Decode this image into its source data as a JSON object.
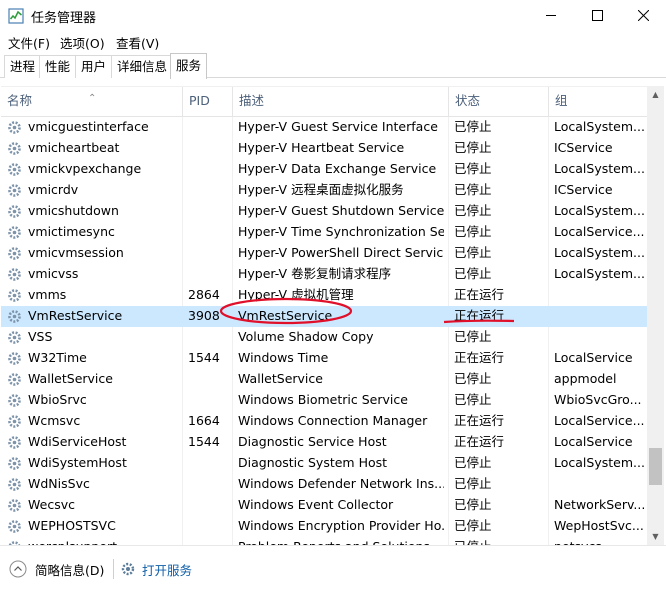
{
  "window": {
    "title": "任务管理器",
    "minimize": "—",
    "maximize": "☐",
    "close": "✕"
  },
  "menu": [
    "文件(F)",
    "选项(O)",
    "查看(V)"
  ],
  "tabs": [
    "进程",
    "性能",
    "用户",
    "详细信息",
    "服务"
  ],
  "active_tab": "服务",
  "columns": [
    "名称",
    "PID",
    "描述",
    "状态",
    "组"
  ],
  "rows": [
    {
      "name": "vmicguestinterface",
      "pid": "",
      "desc": "Hyper-V Guest Service Interface",
      "status": "已停止",
      "group": "LocalSystem..."
    },
    {
      "name": "vmicheartbeat",
      "pid": "",
      "desc": "Hyper-V Heartbeat Service",
      "status": "已停止",
      "group": "ICService"
    },
    {
      "name": "vmickvpexchange",
      "pid": "",
      "desc": "Hyper-V Data Exchange Service",
      "status": "已停止",
      "group": "LocalSystem..."
    },
    {
      "name": "vmicrdv",
      "pid": "",
      "desc": "Hyper-V 远程桌面虚拟化服务",
      "status": "已停止",
      "group": "ICService"
    },
    {
      "name": "vmicshutdown",
      "pid": "",
      "desc": "Hyper-V Guest Shutdown Service",
      "status": "已停止",
      "group": "LocalSystem..."
    },
    {
      "name": "vmictimesync",
      "pid": "",
      "desc": "Hyper-V Time Synchronization Se...",
      "status": "已停止",
      "group": "LocalService..."
    },
    {
      "name": "vmicvmsession",
      "pid": "",
      "desc": "Hyper-V PowerShell Direct Service",
      "status": "已停止",
      "group": "LocalSystem..."
    },
    {
      "name": "vmicvss",
      "pid": "",
      "desc": "Hyper-V 卷影复制请求程序",
      "status": "已停止",
      "group": "LocalSystem..."
    },
    {
      "name": "vmms",
      "pid": "2864",
      "desc": "Hyper-V 虚拟机管理",
      "status": "正在运行",
      "group": ""
    },
    {
      "name": "VmRestService",
      "pid": "3908",
      "desc": "VmRestService",
      "status": "正在运行",
      "group": ""
    },
    {
      "name": "VSS",
      "pid": "",
      "desc": "Volume Shadow Copy",
      "status": "已停止",
      "group": ""
    },
    {
      "name": "W32Time",
      "pid": "1544",
      "desc": "Windows Time",
      "status": "正在运行",
      "group": "LocalService"
    },
    {
      "name": "WalletService",
      "pid": "",
      "desc": "WalletService",
      "status": "已停止",
      "group": "appmodel"
    },
    {
      "name": "WbioSrvc",
      "pid": "",
      "desc": "Windows Biometric Service",
      "status": "已停止",
      "group": "WbioSvcGro..."
    },
    {
      "name": "Wcmsvc",
      "pid": "1664",
      "desc": "Windows Connection Manager",
      "status": "正在运行",
      "group": "LocalService..."
    },
    {
      "name": "WdiServiceHost",
      "pid": "1544",
      "desc": "Diagnostic Service Host",
      "status": "正在运行",
      "group": "LocalService"
    },
    {
      "name": "WdiSystemHost",
      "pid": "",
      "desc": "Diagnostic System Host",
      "status": "已停止",
      "group": "LocalSystem..."
    },
    {
      "name": "WdNisSvc",
      "pid": "",
      "desc": "Windows Defender Network Ins...",
      "status": "已停止",
      "group": ""
    },
    {
      "name": "Wecsvc",
      "pid": "",
      "desc": "Windows Event Collector",
      "status": "已停止",
      "group": "NetworkServ..."
    },
    {
      "name": "WEPHOSTSVC",
      "pid": "",
      "desc": "Windows Encryption Provider Ho...",
      "status": "已停止",
      "group": "WepHostSvc..."
    },
    {
      "name": "wercplsupport",
      "pid": "",
      "desc": "Problem Reports and Solutions...",
      "status": "已停止",
      "group": "netsvcs"
    }
  ],
  "selected_row": 9,
  "footer": {
    "fewer_details": "简略信息(D)",
    "open_services": "打开服务"
  },
  "colors": {
    "selection": "#cce8ff",
    "header_text": "#4c607a",
    "annotation": "#e0102a"
  }
}
